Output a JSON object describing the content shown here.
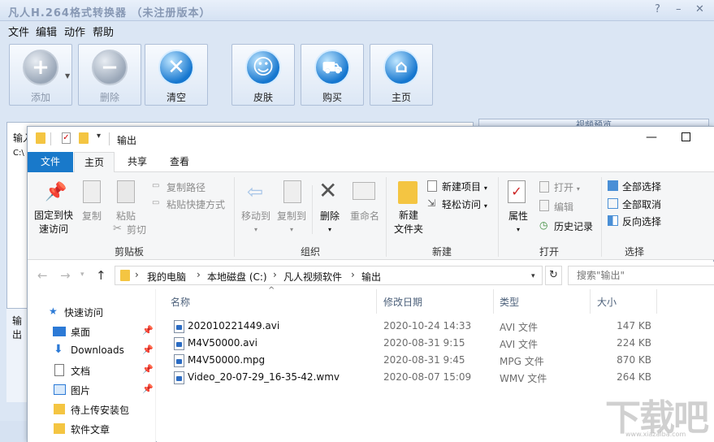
{
  "app": {
    "title": "凡人H.264格式转换器 （未注册版本）",
    "menu": [
      "文件",
      "编辑",
      "动作",
      "帮助"
    ],
    "toolbar": {
      "add": "添加",
      "delete": "删除",
      "clear": "清空",
      "skin": "皮肤",
      "buy": "购买",
      "home": "主页"
    },
    "side_header": "视频预览",
    "input_label": "输入",
    "input_path": "C:\\",
    "output_label": "输出"
  },
  "explorer": {
    "title": "输出",
    "tabs": {
      "file": "文件",
      "home": "主页",
      "share": "共享",
      "view": "查看"
    },
    "ribbon": {
      "clipboard": {
        "label": "剪贴板",
        "pin_line1": "固定到快",
        "pin_line2": "速访问",
        "copy": "复制",
        "paste": "粘贴",
        "copy_path": "复制路径",
        "paste_shortcut": "粘贴快捷方式",
        "cut": "剪切"
      },
      "organize": {
        "label": "组织",
        "move_to": "移动到",
        "copy_to": "复制到",
        "delete": "删除",
        "rename": "重命名"
      },
      "new": {
        "label": "新建",
        "new_folder_line1": "新建",
        "new_folder_line2": "文件夹",
        "new_item": "新建项目",
        "easy_access": "轻松访问"
      },
      "open": {
        "label": "打开",
        "properties": "属性",
        "open": "打开",
        "edit": "编辑",
        "history": "历史记录"
      },
      "select": {
        "label": "选择",
        "select_all": "全部选择",
        "select_none": "全部取消",
        "invert": "反向选择"
      }
    },
    "breadcrumb": [
      "我的电脑",
      "本地磁盘 (C:)",
      "凡人视频软件",
      "输出"
    ],
    "search_placeholder": "搜索\"输出\"",
    "nav": {
      "quick_access": "快速访问",
      "items": [
        "桌面",
        "Downloads",
        "文档",
        "图片",
        "待上传安装包",
        "软件文章"
      ]
    },
    "columns": {
      "name": "名称",
      "modified": "修改日期",
      "type": "类型",
      "size": "大小"
    },
    "files": [
      {
        "name": "202010221449.avi",
        "modified": "2020-10-24 14:33",
        "type": "AVI 文件",
        "size": "147 KB"
      },
      {
        "name": "M4V50000.avi",
        "modified": "2020-08-31 9:15",
        "type": "AVI 文件",
        "size": "224 KB"
      },
      {
        "name": "M4V50000.mpg",
        "modified": "2020-08-31 9:45",
        "type": "MPG 文件",
        "size": "870 KB"
      },
      {
        "name": "Video_20-07-29_16-35-42.wmv",
        "modified": "2020-08-07 15:09",
        "type": "WMV 文件",
        "size": "264 KB"
      }
    ]
  },
  "watermark": {
    "text": "下载吧",
    "url": "www.xiazaiba.com"
  },
  "colors": {
    "accent": "#1979ca",
    "folder": "#f4c542",
    "ribbon_bg": "#f5f6f7"
  }
}
